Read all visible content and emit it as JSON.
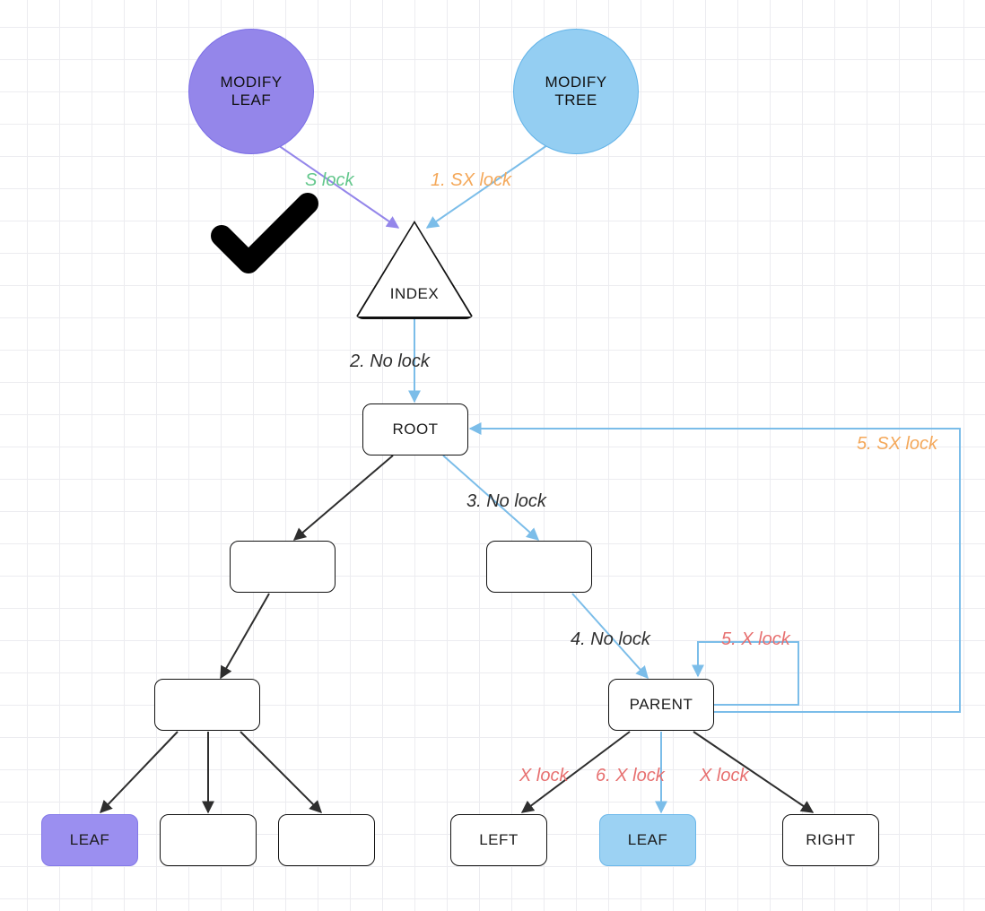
{
  "nodes": {
    "modify_leaf": "MODIFY\nLEAF",
    "modify_tree": "MODIFY\nTREE",
    "index": "INDEX",
    "root": "ROOT",
    "parent": "PARENT",
    "left": "LEFT",
    "leaf_purple": "LEAF",
    "leaf_blue": "LEAF",
    "right": "RIGHT"
  },
  "labels": {
    "s_lock": "S lock",
    "sx_lock_1": "1. SX lock",
    "no_lock_2": "2. No lock",
    "no_lock_3": "3. No lock",
    "no_lock_4": "4. No lock",
    "x_lock_5": "5. X lock",
    "sx_lock_5": "5. SX lock",
    "x_lock_left": "X lock",
    "x_lock_6": "6. X lock",
    "x_lock_right": "X lock"
  },
  "colors": {
    "arrow_dark": "#2e2e2e",
    "arrow_blue": "#7bbde9",
    "arrow_purple": "#9486ea"
  }
}
